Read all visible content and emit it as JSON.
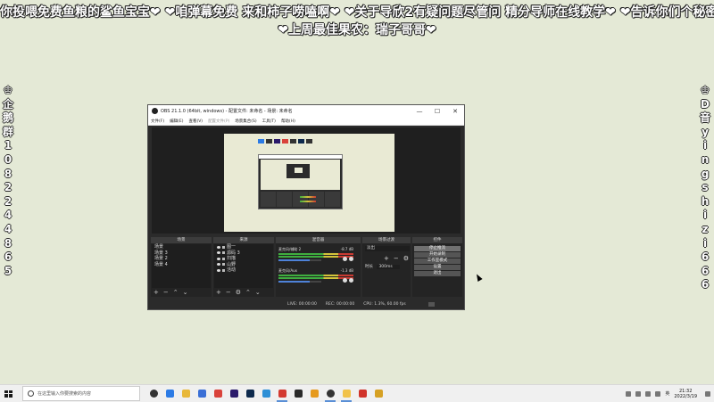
{
  "overlay": {
    "marquee": "你投喂免费鱼粮的鲨鱼宝宝❤ ❤咱弹幕免费 来和柿子唠嗑啊❤ ❤关于导欣2有疑问题尽管问 精分导师在线教学❤ ❤告诉你们个秘密 正",
    "subline": "❤上周最佳果农：瑞子哥哥❤",
    "left_vertical": [
      "♔",
      "企",
      "鹅",
      "群",
      "1",
      "0",
      "8",
      "2",
      "2",
      "4",
      "4",
      "8",
      "6",
      "5"
    ],
    "right_vertical": [
      "♔",
      "D",
      "音",
      "y",
      "i",
      "n",
      "g",
      "s",
      "h",
      "i",
      "z",
      "i",
      "6",
      "6",
      "6"
    ]
  },
  "obs": {
    "title": "OBS 21.1.0 (64bit, windows) - 配置文件: 未命名 - 场景: 未命名",
    "window_controls": [
      "—",
      "☐",
      "✕"
    ],
    "menu": [
      "文件(F)",
      "编辑(E)",
      "查看(V)",
      "配置文件(P)",
      "场景集合(S)",
      "工具(T)",
      "帮助(H)"
    ],
    "docks": {
      "scenes": {
        "header": "场景",
        "items": [
          "场景",
          "场景 3",
          "场景 2",
          "场景 4"
        ]
      },
      "sources": {
        "header": "来源",
        "items": [
          "图一",
          "源码 3",
          "扫描",
          "山野",
          "活动"
        ]
      },
      "mixer": {
        "header": "混音器",
        "channels": [
          {
            "name": "麦克风/辅助 2",
            "db": "-8.7 dB"
          },
          {
            "name": "麦克风/Aux",
            "db": "-1.3 dB"
          }
        ]
      },
      "transitions": {
        "header": "场景过渡",
        "selected": "淡出",
        "duration_label": "时长",
        "duration_value": "300ms"
      },
      "controls": {
        "header": "控件",
        "buttons": [
          "停止推流",
          "开始录制",
          "工作室模式",
          "设置",
          "退出"
        ]
      }
    },
    "status": {
      "live": "LIVE: 00:00:00",
      "rec": "REC: 00:00:00",
      "cpu": "CPU: 1.3%, 60.00 fps"
    }
  },
  "taskbar": {
    "search_placeholder": "在这里输入你要搜索的内容",
    "ime_lang": "英",
    "time": "21:32",
    "date": "2022/3/19",
    "apps": [
      {
        "name": "task-view-icon",
        "color": "#333333"
      },
      {
        "name": "edge-icon",
        "color": "#2c7be5"
      },
      {
        "name": "file-explorer-icon",
        "color": "#e8b83a"
      },
      {
        "name": "store-icon",
        "color": "#3a6fd6"
      },
      {
        "name": "chrome-icon",
        "color": "#d9423b"
      },
      {
        "name": "premiere-icon",
        "color": "#2b1a6b"
      },
      {
        "name": "photoshop-icon",
        "color": "#0e2a4d"
      },
      {
        "name": "twitter-bird-icon",
        "color": "#2d8fd6"
      },
      {
        "name": "netease-music-icon",
        "color": "#d33a31"
      },
      {
        "name": "game-icon",
        "color": "#2a2a2a"
      },
      {
        "name": "tool-icon",
        "color": "#e69a1e"
      },
      {
        "name": "obs-icon",
        "color": "#333333"
      },
      {
        "name": "folder-icon",
        "color": "#f1c24a"
      },
      {
        "name": "video-icon",
        "color": "#d0332b"
      },
      {
        "name": "map-icon",
        "color": "#d6a124"
      }
    ]
  }
}
